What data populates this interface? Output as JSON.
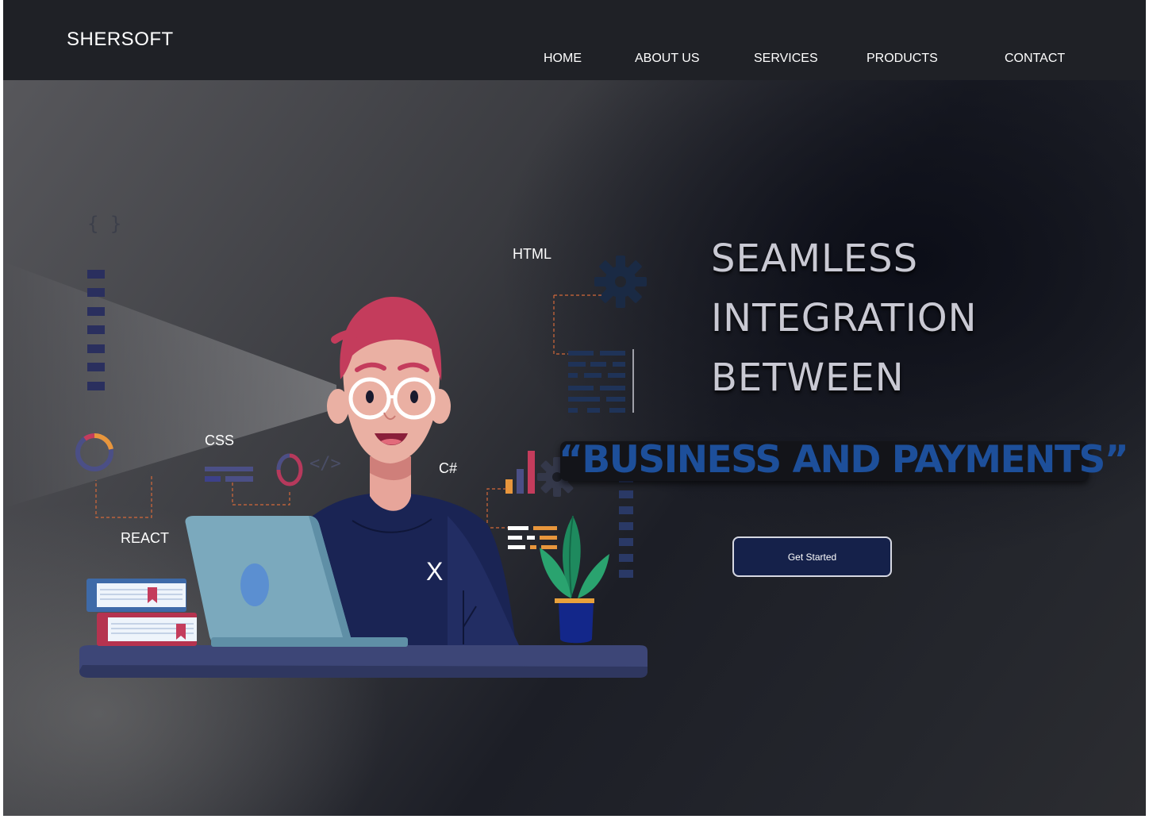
{
  "header": {
    "brand": "SHERSOFT",
    "nav": [
      "HOME",
      "ABOUT US",
      "SERVICES",
      "PRODUCTS",
      "CONTACT"
    ]
  },
  "hero": {
    "lines": [
      "SEAMLESS",
      "INTEGRATION",
      "BETWEEN"
    ],
    "highlight": "“BUSINESS AND PAYMENTS”",
    "cta_label": "Get Started"
  },
  "illustration": {
    "labels": {
      "html": "HTML",
      "css": "CSS",
      "csharp": "C#",
      "react": "REACT",
      "x": "X",
      "braces": "{ }",
      "code_tag": "</>"
    }
  },
  "colors": {
    "header_bg": "#1f2126",
    "highlight_text": "#1d4f9a",
    "cta_bg": "#15214a",
    "hair": "#c43c5c"
  }
}
